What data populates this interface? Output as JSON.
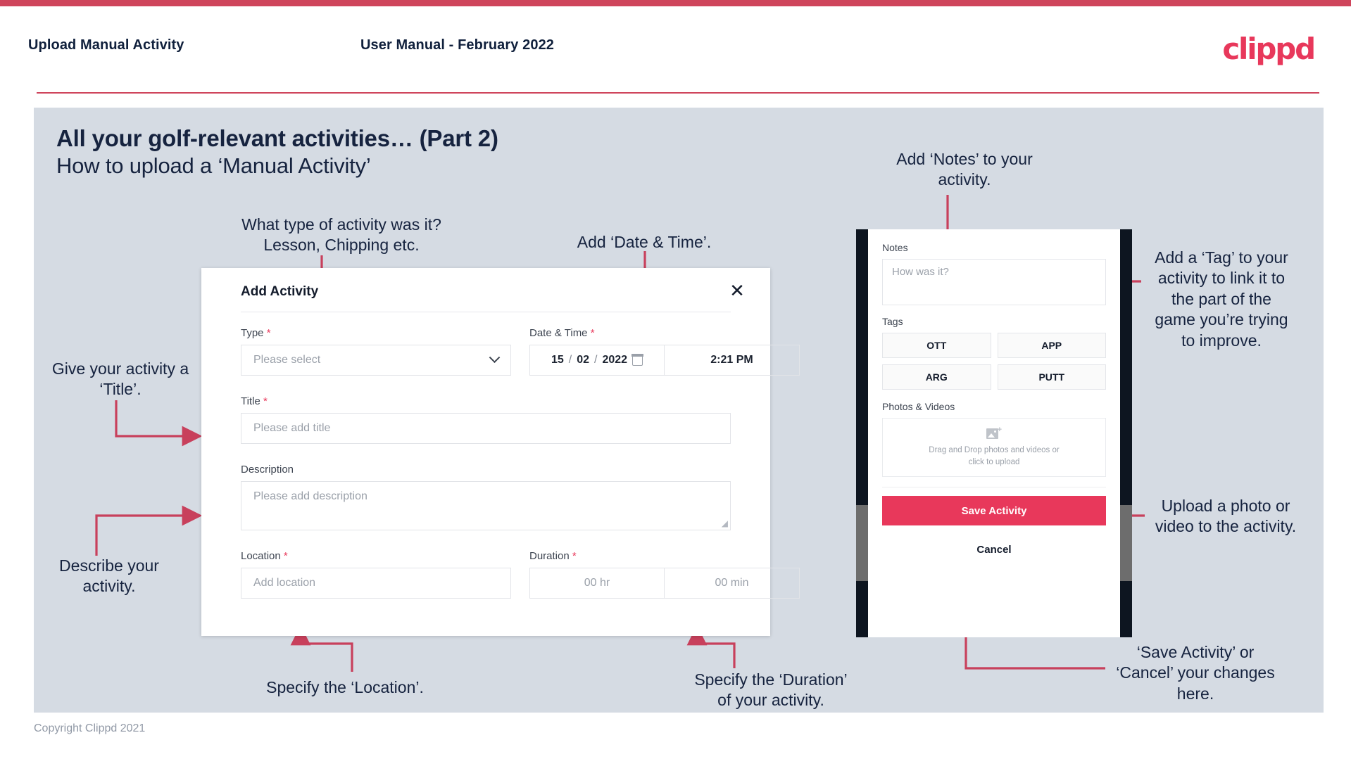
{
  "header": {
    "title": "Upload Manual Activity",
    "subtitle": "User Manual - February 2022",
    "logo": "clippd"
  },
  "slide": {
    "title": "All your golf-relevant activities… (Part 2)",
    "subtitle": "How to upload a ‘Manual Activity’",
    "copyright": "Copyright Clippd 2021"
  },
  "dialog": {
    "title": "Add Activity",
    "close_icon": "close-icon",
    "fields": {
      "type": {
        "label": "Type",
        "required": "*",
        "placeholder": "Please select"
      },
      "datetime": {
        "label": "Date & Time",
        "required": "*",
        "day": "15",
        "month": "02",
        "year": "2022",
        "sep": "/",
        "time": "2:21 PM"
      },
      "title": {
        "label": "Title",
        "required": "*",
        "placeholder": "Please add title"
      },
      "description": {
        "label": "Description",
        "placeholder": "Please add description"
      },
      "location": {
        "label": "Location",
        "required": "*",
        "placeholder": "Add location"
      },
      "duration": {
        "label": "Duration",
        "required": "*",
        "hours": "00 hr",
        "minutes": "00 min"
      }
    }
  },
  "phone": {
    "notes": {
      "label": "Notes",
      "placeholder": "How was it?"
    },
    "tags": {
      "label": "Tags",
      "items": [
        "OTT",
        "APP",
        "ARG",
        "PUTT"
      ]
    },
    "photos": {
      "label": "Photos & Videos",
      "dropzone_line1": "Drag and Drop photos and videos or",
      "dropzone_line2": "click to upload",
      "icon": "add-image-icon"
    },
    "save_label": "Save Activity",
    "cancel_label": "Cancel"
  },
  "annotations": {
    "type": "What type of activity was it?\nLesson, Chipping etc.",
    "datetime": "Add ‘Date & Time’.",
    "title": "Give your activity a\n‘Title’.",
    "description": "Describe your\nactivity.",
    "location": "Specify the ‘Location’.",
    "duration": "Specify the ‘Duration’\nof your activity.",
    "notes": "Add ‘Notes’ to your\nactivity.",
    "tags": "Add a ‘Tag’ to your\nactivity to link it to\nthe part of the\ngame you’re trying\nto improve.",
    "upload": "Upload a photo or\nvideo to the activity.",
    "save": "‘Save Activity’ or\n‘Cancel’ your changes\nhere."
  },
  "colors": {
    "accent": "#e8385b",
    "accent_bar": "#cf455c",
    "slide_bg": "#d5dbe3",
    "ink": "#16233f"
  }
}
